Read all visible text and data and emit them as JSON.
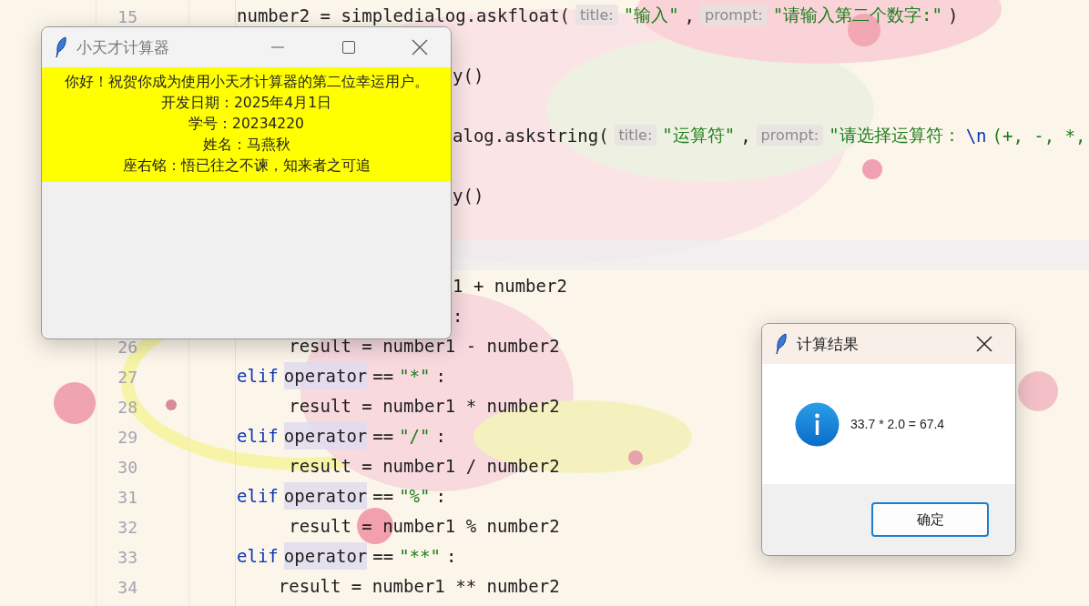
{
  "editor": {
    "lines": [
      {
        "number": "15",
        "kind": "full",
        "tokens": [
          {
            "text": "number2 = simpledialog.askfloat(",
            "kind": "plain"
          },
          {
            "text": "title:",
            "kind": "hint"
          },
          {
            "text": "\"输入\"",
            "kind": "string"
          },
          {
            "text": ",",
            "kind": "plain"
          },
          {
            "text": "prompt:",
            "kind": "hint"
          },
          {
            "text": "\"请输入第二个数字:\"",
            "kind": "string"
          },
          {
            "text": ")",
            "kind": "plain"
          }
        ]
      },
      {
        "kind": "partial"
      },
      {
        "kind": "partial",
        "tokens": [
          {
            "text": "y()",
            "kind": "plain"
          }
        ]
      },
      {
        "kind": "partial"
      },
      {
        "kind": "partial",
        "tokens": [
          {
            "text": "alog.askstring(",
            "kind": "plain"
          },
          {
            "text": "title:",
            "kind": "hint"
          },
          {
            "text": "\"运算符\"",
            "kind": "string"
          },
          {
            "text": ",",
            "kind": "plain"
          },
          {
            "text": "prompt:",
            "kind": "hint"
          },
          {
            "text": "\"请选择运算符：",
            "kind": "string"
          },
          {
            "text": "\\n",
            "kind": "escape"
          },
          {
            "text": "(+, -, *,",
            "kind": "string"
          }
        ]
      },
      {
        "kind": "partial"
      },
      {
        "kind": "partial",
        "tokens": [
          {
            "text": "y()",
            "kind": "plain"
          }
        ]
      },
      {
        "kind": "partial"
      },
      {
        "kind": "partial",
        "current": true
      },
      {
        "kind": "partial",
        "tokens": [
          {
            "text": "1 + number2",
            "kind": "plain"
          }
        ]
      },
      {
        "kind": "partial",
        "tokens": [
          {
            "text": ":",
            "kind": "plain"
          }
        ]
      },
      {
        "number": "26",
        "kind": "full",
        "tokens": [
          {
            "text": "     result = number1 - number2",
            "kind": "plain"
          }
        ]
      },
      {
        "number": "27",
        "kind": "full",
        "tokens": [
          {
            "text": "elif",
            "kind": "keyword"
          },
          {
            "text": "operator",
            "kind": "highlight"
          },
          {
            "text": "==",
            "kind": "plain"
          },
          {
            "text": "\"*\"",
            "kind": "string"
          },
          {
            "text": ":",
            "kind": "plain"
          }
        ]
      },
      {
        "number": "28",
        "kind": "full",
        "tokens": [
          {
            "text": "     result = number1 * number2",
            "kind": "plain"
          }
        ]
      },
      {
        "number": "29",
        "kind": "full",
        "tokens": [
          {
            "text": "elif",
            "kind": "keyword"
          },
          {
            "text": "operator",
            "kind": "highlight"
          },
          {
            "text": "==",
            "kind": "plain"
          },
          {
            "text": "\"/\"",
            "kind": "string"
          },
          {
            "text": ":",
            "kind": "plain"
          }
        ]
      },
      {
        "number": "30",
        "kind": "full",
        "tokens": [
          {
            "text": "     result = number1 / number2",
            "kind": "plain"
          }
        ]
      },
      {
        "number": "31",
        "kind": "full",
        "tokens": [
          {
            "text": "elif",
            "kind": "keyword"
          },
          {
            "text": "operator",
            "kind": "highlight"
          },
          {
            "text": "==",
            "kind": "plain"
          },
          {
            "text": "\"%\"",
            "kind": "string"
          },
          {
            "text": ":",
            "kind": "plain"
          }
        ]
      },
      {
        "number": "32",
        "kind": "full",
        "tokens": [
          {
            "text": "     result = number1 % number2",
            "kind": "plain"
          }
        ]
      },
      {
        "number": "33",
        "kind": "full",
        "tokens": [
          {
            "text": "elif",
            "kind": "keyword"
          },
          {
            "text": "operator",
            "kind": "highlight"
          },
          {
            "text": "==",
            "kind": "plain"
          },
          {
            "text": "\"**\"",
            "kind": "string"
          },
          {
            "text": ":",
            "kind": "plain"
          }
        ]
      },
      {
        "number": "34",
        "kind": "full",
        "tokens": [
          {
            "text": "    result = number1 ** number2",
            "kind": "plain"
          }
        ]
      }
    ]
  },
  "main_window": {
    "title": "小天才计算器",
    "active": false,
    "label_lines": [
      "你好！祝贺你成为使用小天才计算器的第二位幸运用户。",
      "开发日期：2025年4月1日",
      "学号：20234220",
      "姓名：马燕秋",
      "座右铭：悟已往之不谏，知来者之可追"
    ]
  },
  "dialog": {
    "title": "计算结果",
    "active": true,
    "message": "33.7 * 2.0 = 67.4",
    "button": {
      "label": "确定",
      "focused": true
    }
  }
}
